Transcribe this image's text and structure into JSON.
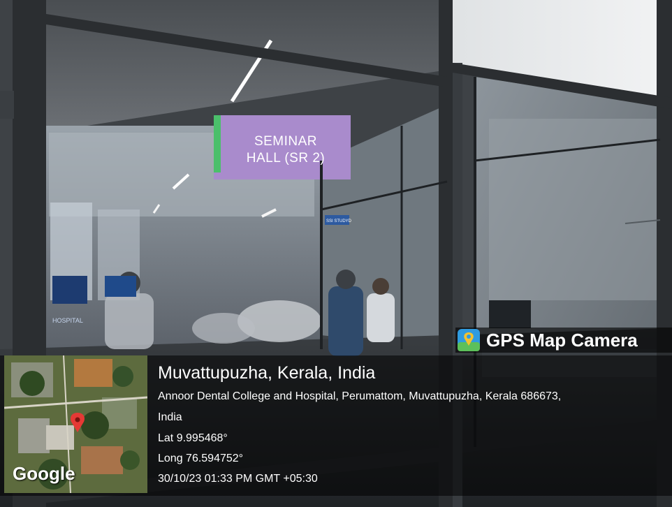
{
  "sign": {
    "line1": "SEMINAR",
    "line2": "HALL (SR 2)"
  },
  "wall_text": {
    "far_sign": "HOSPITAL",
    "door_sign": "SSI STUDYD"
  },
  "overlay": {
    "app_title": "GPS Map Camera",
    "icon": "gps-map-camera-icon",
    "place_title": "Muvattupuzha, Kerala, India",
    "address_line1": "Annoor Dental College and Hospital, Perumattom, Muvattupuzha, Kerala 686673,",
    "address_line2": "India",
    "latitude": "Lat 9.995468°",
    "longitude": "Long 76.594752°",
    "datetime": "30/10/23 01:33 PM GMT +05:30",
    "map_logo": "Google"
  },
  "colors": {
    "sign_purple": "#a98bcc",
    "sign_green_edge": "#4bbf6b",
    "frame_dark": "#2b2e31",
    "map_pin_red": "#e53935"
  }
}
